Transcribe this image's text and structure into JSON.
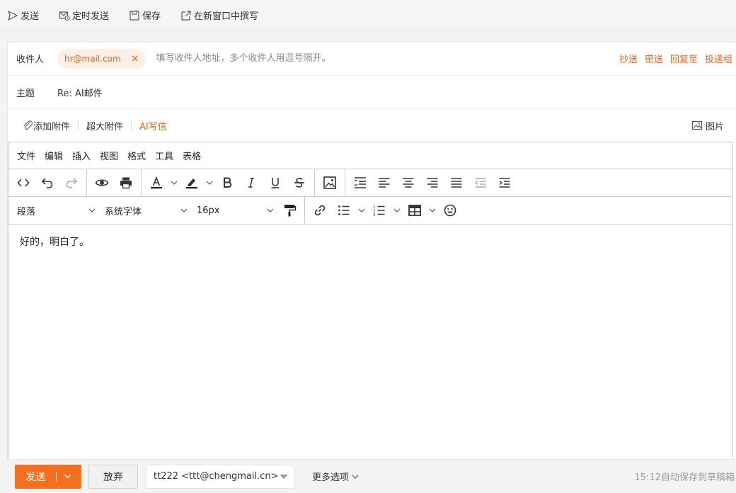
{
  "toolbar": {
    "send": "发送",
    "scheduled_send": "定时发送",
    "save": "保存",
    "compose_new_window": "在新窗口中撰写"
  },
  "recipients": {
    "label": "收件人",
    "chip": "hr@mail.com",
    "remove": "×",
    "placeholder": "填写收件人地址，多个收件人用逗号隔开。",
    "cc": "抄送",
    "bcc": "密送",
    "reply_to": "回复至",
    "group_send": "投递组"
  },
  "subject": {
    "label": "主题",
    "value": "Re: AI邮件"
  },
  "attachments": {
    "add": "添加附件",
    "large": "超大附件",
    "ai_write": "AI写信",
    "image": "图片"
  },
  "editor": {
    "menu": [
      "文件",
      "编辑",
      "插入",
      "视图",
      "格式",
      "工具",
      "表格"
    ],
    "block_format": "段落",
    "font_family": "系统字体",
    "font_size": "16px",
    "body": "好的，明白了。"
  },
  "bottom": {
    "send": "发送",
    "discard": "放弃",
    "from": "tt222 <ttt@chengmail.cn>",
    "more_options": "更多选项",
    "autosave": "15:12自动保存到草稿箱"
  },
  "colors": {
    "accent": "#f4701f",
    "link": "#e8631a",
    "chip_bg": "#fdeee6"
  }
}
